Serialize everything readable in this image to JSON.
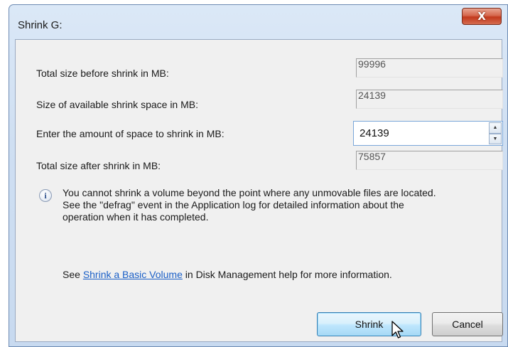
{
  "window": {
    "title": "Shrink G:",
    "close_glyph": "X"
  },
  "fields": {
    "total_before_label": "Total size before shrink in MB:",
    "total_before_value": "99996",
    "available_label": "Size of available shrink space in MB:",
    "available_value": "24139",
    "amount_label": "Enter the amount of space to shrink in MB:",
    "amount_value": "24139",
    "total_after_label": "Total size after shrink in MB:",
    "total_after_value": "75857"
  },
  "spinner": {
    "up_glyph": "▲",
    "down_glyph": "▼"
  },
  "info": {
    "icon": "info-icon",
    "icon_glyph": "i",
    "lines": [
      "You cannot shrink a volume beyond the point where any unmovable files are located.",
      "See the \"defrag\" event in the Application log for detailed information about the",
      "operation when it has completed."
    ]
  },
  "help": {
    "prefix": "See ",
    "link_text": "Shrink a Basic Volume",
    "suffix": " in Disk Management help for more information."
  },
  "buttons": {
    "shrink": "Shrink",
    "cancel": "Cancel"
  },
  "colors": {
    "link": "#1a5fc7",
    "close_button": "#c2391d",
    "default_button_border": "#3c7fb1"
  }
}
